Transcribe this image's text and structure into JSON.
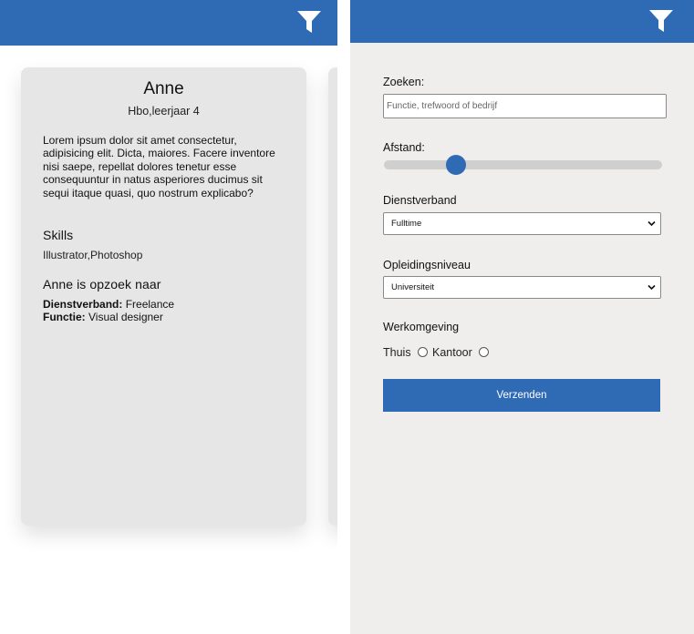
{
  "colors": {
    "primary": "#2f6ab5",
    "card_bg": "#e6e6e6",
    "form_bg": "#efeeec",
    "slider_track": "#cfcfcf"
  },
  "left_header": {
    "filter_icon": "filter-icon"
  },
  "profile_card": {
    "name": "Anne",
    "education": "Hbo,leerjaar 4",
    "description": "Lorem ipsum dolor sit amet consectetur, adipisicing elit. Dicta, maiores. Facere inventore nisi saepe, repellat dolores tenetur esse consequuntur in natus asperiores ducimus sit sequi itaque quasi, quo nostrum explicabo?",
    "skills_title": "Skills",
    "skills": "Illustrator,Photoshop",
    "looking_for_title": "Anne is opzoek naar",
    "employment_label": "Dienstverband:",
    "employment_value": "Freelance",
    "function_label": "Functie:",
    "function_value": "Visual designer"
  },
  "right_header": {
    "filter_icon": "filter-icon"
  },
  "filter_form": {
    "search_label": "Zoeken:",
    "search_placeholder": "Functie, trefwoord of bedrijf",
    "search_value": "",
    "distance_label": "Afstand:",
    "distance_value": 0.26,
    "employment_label": "Dienstverband",
    "employment_selected": "Fulltime",
    "education_label": "Opleidingsniveau",
    "education_selected": "Universiteit",
    "workplace_label": "Werkomgeving",
    "workplace_options": [
      "Thuis",
      "Kantoor"
    ],
    "submit_label": "Verzenden"
  }
}
